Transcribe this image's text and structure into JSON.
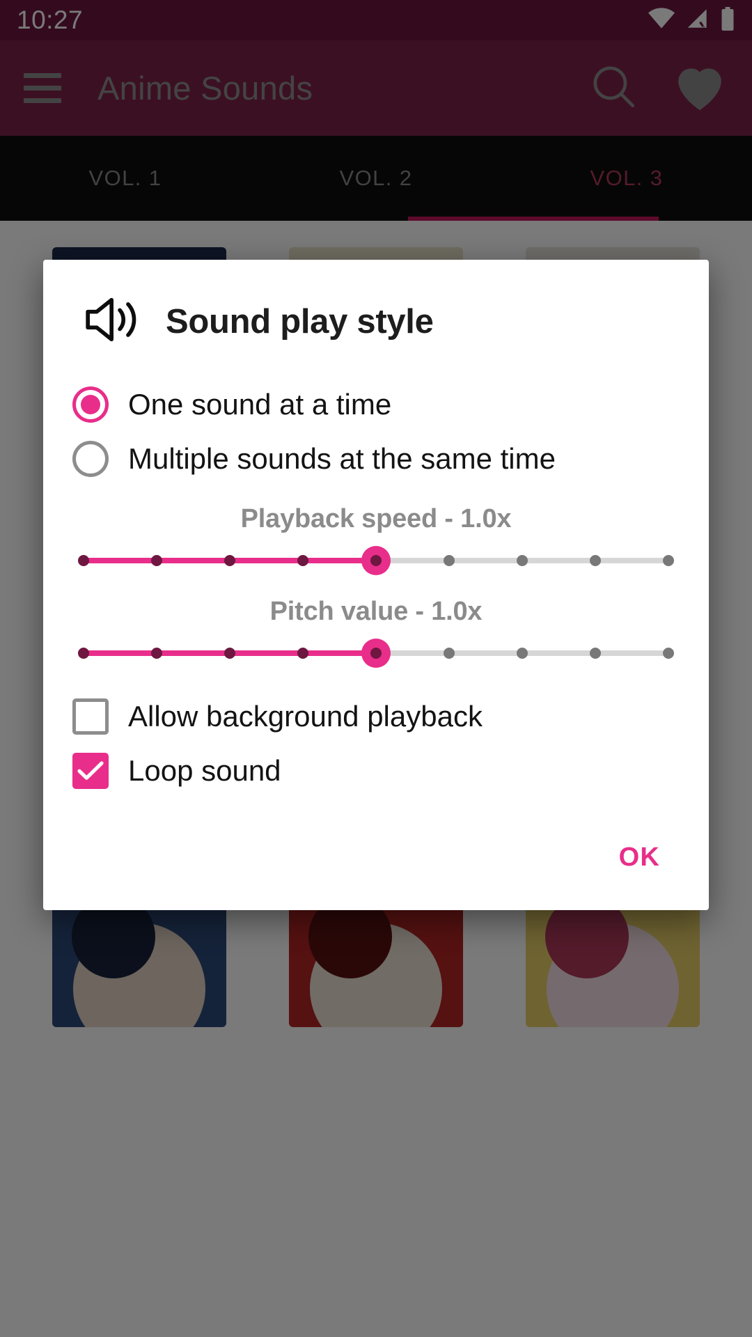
{
  "statusbar": {
    "time": "10:27",
    "icons": [
      {
        "name": "wifi-icon",
        "label": "wifi"
      },
      {
        "name": "cellular-signal-off-icon",
        "label": "signal-no-sim"
      },
      {
        "name": "battery-full-icon",
        "label": "battery"
      }
    ]
  },
  "appbar": {
    "menu_icon": "hamburger-menu-icon",
    "title": "Anime Sounds",
    "search_icon": "search-icon",
    "favorites_icon": "heart-icon"
  },
  "tabs": [
    {
      "label": "VOL. 1",
      "active": false
    },
    {
      "label": "VOL. 2",
      "active": false
    },
    {
      "label": "VOL. 3",
      "active": true
    }
  ],
  "dialog": {
    "icon": "volume-up-icon",
    "title": "Sound play style",
    "radios": [
      {
        "label": "One sound at a time",
        "checked": true
      },
      {
        "label": "Multiple sounds at the same time",
        "checked": false
      }
    ],
    "sliders": [
      {
        "label": "Playback speed - 1.0x",
        "name": "playback-speed-slider",
        "value": "1.0x",
        "ticks": 9,
        "index": 4
      },
      {
        "label": "Pitch value - 1.0x",
        "name": "pitch-value-slider",
        "value": "1.0x",
        "ticks": 9,
        "index": 4
      }
    ],
    "checkboxes": [
      {
        "label": "Allow background playback",
        "checked": false
      },
      {
        "label": "Loop sound",
        "checked": true
      }
    ],
    "ok_label": "OK"
  },
  "colors": {
    "accent_pink": "#E82E8A",
    "statusbar_maroon": "#6E1740",
    "appbar_maroon": "#7E2349",
    "tabbar_black": "#0D0D0D",
    "tab_active": "#B03A5B",
    "dialog_bg": "#FFFFFF"
  },
  "background_grid": [
    {
      "name": "thumb-sailor",
      "c1": "#1d2a4d",
      "c2": "#e8d9b0",
      "c3": "#2b3a60"
    },
    {
      "name": "thumb-yellow",
      "c1": "#e8e2c8",
      "c2": "#d8cc8e",
      "c3": "#8a7f50"
    },
    {
      "name": "thumb-pale",
      "c1": "#e9e4dc",
      "c2": "#cfc7bb",
      "c3": "#7d7368"
    },
    {
      "name": "thumb-orange",
      "c1": "#d9743e",
      "c2": "#f0c9a0",
      "c3": "#3a2b22"
    },
    {
      "name": "thumb-green",
      "c1": "#0f5c44",
      "c2": "#1d7a5c",
      "c3": "#093226"
    },
    {
      "name": "thumb-dark",
      "c1": "#2a2a2a",
      "c2": "#4a4a4a",
      "c3": "#111111"
    },
    {
      "name": "thumb-purple",
      "c1": "#3c2450",
      "c2": "#6b4a85",
      "c3": "#1e1228"
    },
    {
      "name": "thumb-butler",
      "c1": "#1a1a1a",
      "c2": "#efe7df",
      "c3": "#3b3b3b"
    },
    {
      "name": "thumb-skeleton",
      "c1": "#6e6a62",
      "c2": "#c9b04a",
      "c3": "#8e2b2b"
    },
    {
      "name": "thumb-bluehair",
      "c1": "#2d4a7a",
      "c2": "#e3d3c4",
      "c3": "#17233c"
    },
    {
      "name": "thumb-redcap",
      "c1": "#b32424",
      "c2": "#ece2d6",
      "c3": "#5a1212"
    },
    {
      "name": "thumb-blonde",
      "c1": "#e8cf6a",
      "c2": "#f4dfe6",
      "c3": "#b03a5b"
    }
  ]
}
